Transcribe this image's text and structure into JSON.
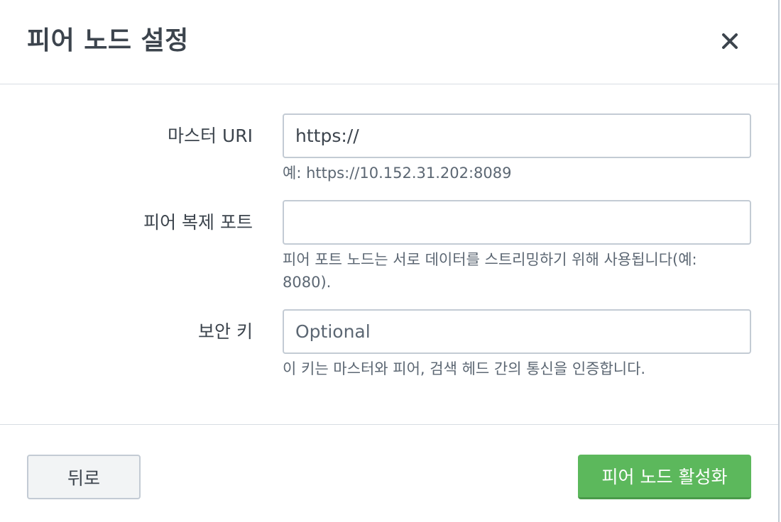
{
  "dialog": {
    "title": "피어 노드 설정",
    "close_icon": "close-icon"
  },
  "fields": {
    "master_uri": {
      "label": "마스터 URI",
      "value": "https://",
      "help": "예: https://10.152.31.202:8089"
    },
    "replication_port": {
      "label": "피어 복제 포트",
      "value": "",
      "help": "피어 포트 노드는 서로 데이터를 스트리밍하기 위해 사용됩니다(예: 8080)."
    },
    "security_key": {
      "label": "보안 키",
      "placeholder": "Optional",
      "help": "이 키는 마스터와 피어, 검색 헤드 간의 통신을 인증합니다."
    }
  },
  "footer": {
    "back_label": "뒤로",
    "enable_label": "피어 노드 활성화"
  },
  "colors": {
    "primary": "#5cb85c",
    "border": "#c3cbd4",
    "text": "#3c444d",
    "help_text": "#5c6773"
  }
}
